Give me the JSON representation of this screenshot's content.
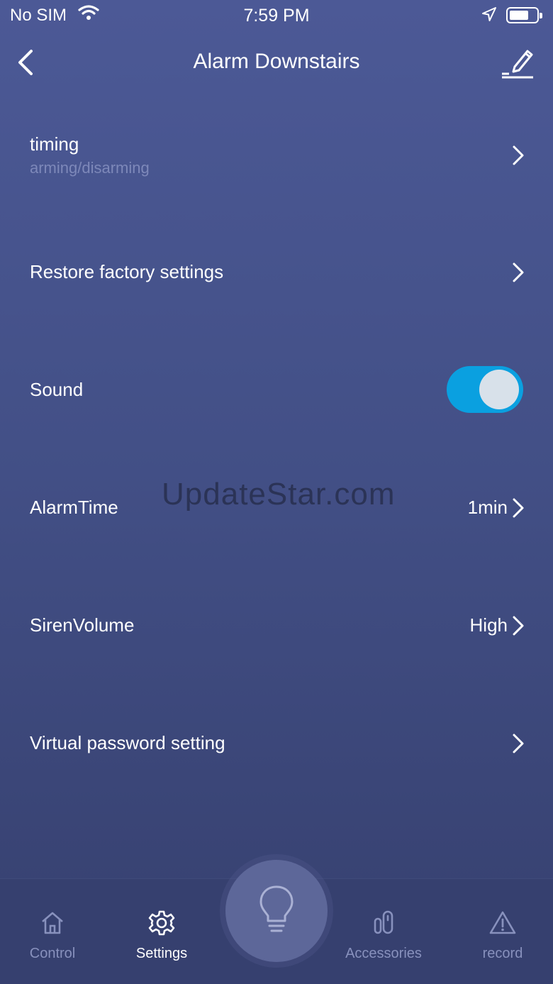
{
  "status_bar": {
    "carrier": "No SIM",
    "time": "7:59 PM",
    "wifi_icon": "wifi-icon",
    "location_icon": "location-arrow-icon",
    "battery_icon": "battery-icon"
  },
  "nav": {
    "title": "Alarm Downstairs",
    "back_icon": "chevron-left-icon",
    "edit_icon": "edit-pencil-icon"
  },
  "settings": {
    "timing": {
      "label": "timing",
      "sublabel": "arming/disarming"
    },
    "restore": {
      "label": "Restore factory settings"
    },
    "sound": {
      "label": "Sound",
      "enabled": true
    },
    "alarm_time": {
      "label": "AlarmTime",
      "value": "1min"
    },
    "siren_volume": {
      "label": "SirenVolume",
      "value": "High"
    },
    "virtual_password": {
      "label": "Virtual password setting"
    }
  },
  "watermark": "UpdateStar.com",
  "tabbar": {
    "tabs": [
      {
        "label": "Control",
        "icon": "home-icon",
        "active": false
      },
      {
        "label": "Settings",
        "icon": "gear-icon",
        "active": true
      },
      {
        "label": "Accessories",
        "icon": "accessories-icon",
        "active": false
      },
      {
        "label": "record",
        "icon": "warning-triangle-icon",
        "active": false
      }
    ],
    "center_icon": "lightbulb-icon"
  },
  "colors": {
    "background_top": "#4c5996",
    "background_bottom": "#36406f",
    "toggle_on": "#0aa0e0",
    "tab_inactive": "#8891bd",
    "sublabel": "#7d88b9"
  }
}
